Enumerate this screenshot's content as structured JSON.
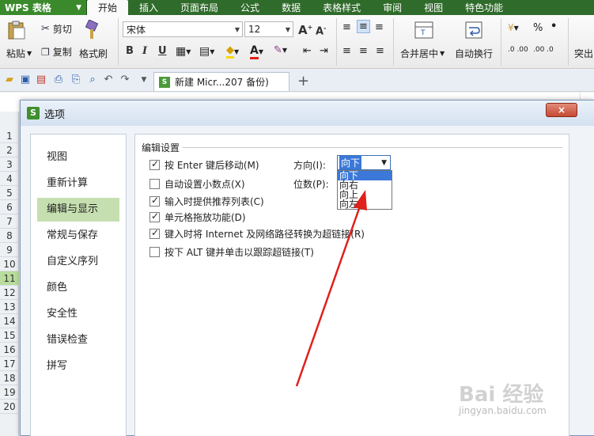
{
  "app": {
    "name": "WPS 表格"
  },
  "menu": [
    "开始",
    "插入",
    "页面布局",
    "公式",
    "数据",
    "表格样式",
    "审阅",
    "视图",
    "特色功能"
  ],
  "ribbon": {
    "cut": "剪切",
    "paste": "粘贴",
    "copy": "复制",
    "format_painter": "格式刷",
    "font_name": "宋体",
    "font_size": "12",
    "bold": "B",
    "italic": "I",
    "underline": "U",
    "merge_center": "合并居中",
    "wrap_text": "自动换行",
    "percent": "%",
    "comma": "•",
    "dec_inc": ".0 .00",
    "dec_dec": ".00 .0",
    "highlight": "突出"
  },
  "tabbar": {
    "doc_tab": "新建 Micr...207 备份)",
    "add_tab": "+"
  },
  "sheet": {
    "row_numbers": [
      "1",
      "2",
      "3",
      "4",
      "5",
      "6",
      "7",
      "8",
      "9",
      "10",
      "11",
      "12",
      "13",
      "14",
      "15",
      "16",
      "17",
      "18",
      "19",
      "20"
    ],
    "selected_row": "11"
  },
  "dialog": {
    "title": "选项",
    "close": "×",
    "nav": [
      "视图",
      "重新计算",
      "编辑与显示",
      "常规与保存",
      "自定义序列",
      "颜色",
      "安全性",
      "错误检查",
      "拼写"
    ],
    "active_nav": "编辑与显示",
    "group_title": "编辑设置",
    "options": [
      {
        "label": "按 Enter 键后移动(M)",
        "checked": true
      },
      {
        "label": "自动设置小数点(X)",
        "checked": false
      },
      {
        "label": "输入时提供推荐列表(C)",
        "checked": true
      },
      {
        "label": "单元格拖放功能(D)",
        "checked": true
      },
      {
        "label": "键入时将 Internet 及网络路径转换为超链接(R)",
        "checked": true
      },
      {
        "label": "按下 ALT 键并单击以跟踪超链接(T)",
        "checked": false
      }
    ],
    "direction_label": "方向(I):",
    "digits_label": "位数(P):",
    "direction_value": "向下",
    "direction_options": [
      "向下",
      "向右",
      "向上",
      "向左"
    ]
  },
  "watermark": {
    "brand": "Bai 经验",
    "url": "jingyan.baidu.com"
  },
  "colors": {
    "menu_green": "#2f6b2a",
    "nav_active": "#c6dfb0",
    "select_blue": "#3b78d8",
    "arrow_red": "#e0201a"
  }
}
